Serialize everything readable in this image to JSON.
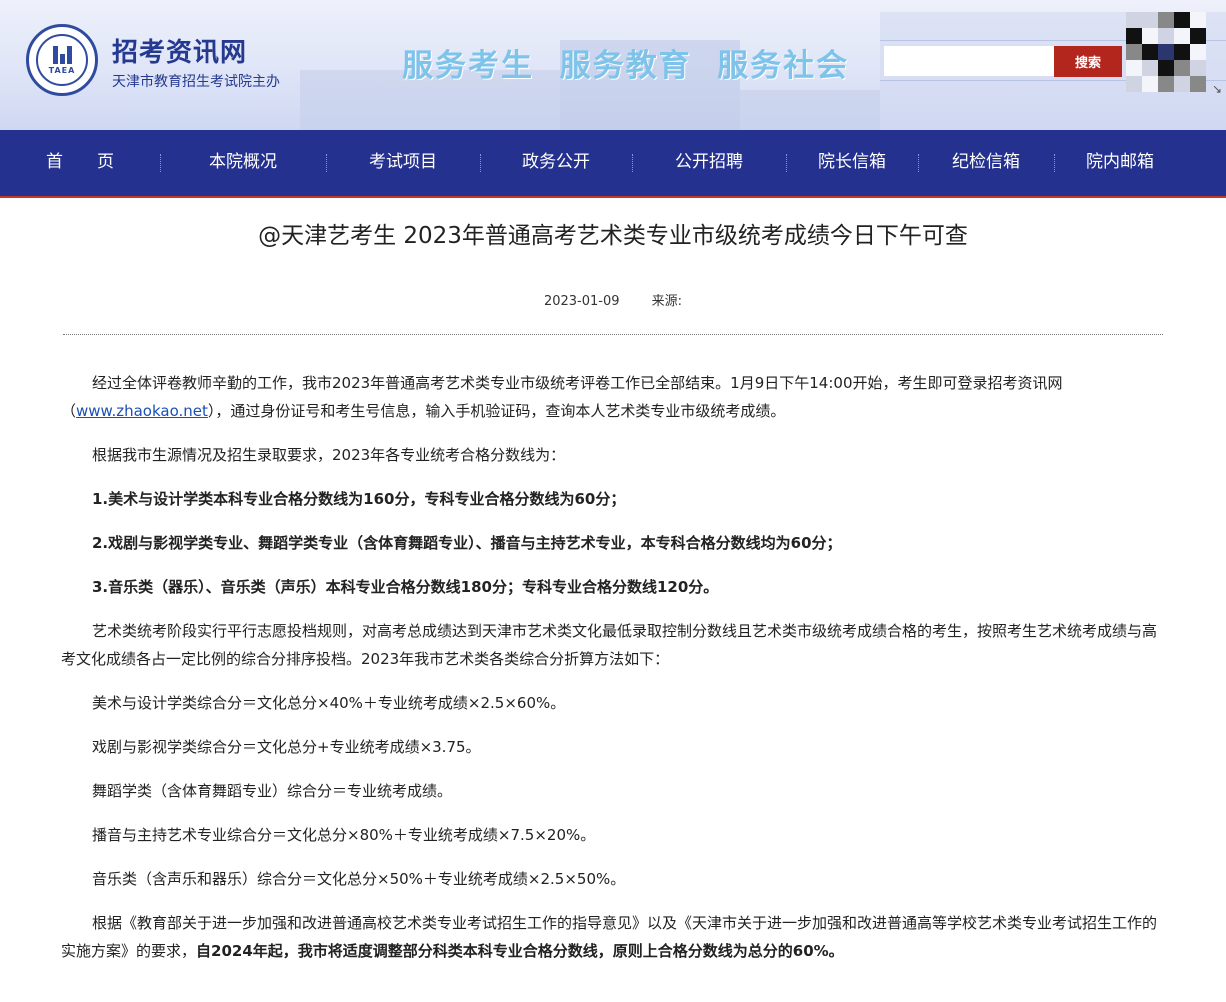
{
  "header": {
    "logo_abbr": "TAEA",
    "site_name": "招考资讯网",
    "site_sub": "天津市教育招生考试院主办",
    "slogan": "服务考生  服务教育  服务社会",
    "search_placeholder": "",
    "search_button": "搜索"
  },
  "nav": {
    "items": [
      "首　　页",
      "本院概况",
      "考试项目",
      "政务公开",
      "公开招聘",
      "院长信箱",
      "纪检信箱",
      "院内邮箱"
    ]
  },
  "article": {
    "title": "@天津艺考生 2023年普通高考艺术类专业市级统考成绩今日下午可查",
    "date": "2023-01-09",
    "source_label": "来源:",
    "p1_a": "经过全体评卷教师辛勤的工作，我市2023年普通高考艺术类专业市级统考评卷工作已全部结束。1月9日下午14:00开始，考生即可登录招考资讯网（",
    "p1_link": "www.zhaokao.net",
    "p1_b": "），通过身份证号和考生号信息，输入手机验证码，查询本人艺术类专业市级统考成绩。",
    "p2": "根据我市生源情况及招生录取要求，2023年各专业统考合格分数线为：",
    "p3": "1.美术与设计学类本科专业合格分数线为160分，专科专业合格分数线为60分；",
    "p4": "2.戏剧与影视学类专业、舞蹈学类专业（含体育舞蹈专业）、播音与主持艺术专业，本专科合格分数线均为60分；",
    "p5": "3.音乐类（器乐）、音乐类（声乐）本科专业合格分数线180分；专科专业合格分数线120分。",
    "p6": "艺术类统考阶段实行平行志愿投档规则，对高考总成绩达到天津市艺术类文化最低录取控制分数线且艺术类市级统考成绩合格的考生，按照考生艺术统考成绩与高考文化成绩各占一定比例的综合分排序投档。2023年我市艺术类各类综合分折算方法如下：",
    "p7": "美术与设计学类综合分＝文化总分×40%＋专业统考成绩×2.5×60%。",
    "p8": "戏剧与影视学类综合分＝文化总分+专业统考成绩×3.75。",
    "p9": "舞蹈学类（含体育舞蹈专业）综合分＝专业统考成绩。",
    "p10": "播音与主持艺术专业综合分＝文化总分×80%＋专业统考成绩×7.5×20%。",
    "p11": "音乐类（含声乐和器乐）综合分＝文化总分×50%＋专业统考成绩×2.5×50%。",
    "p12_a": "根据《教育部关于进一步加强和改进普通高校艺术类专业考试招生工作的指导意见》以及《天津市关于进一步加强和改进普通高等学校艺术类专业考试招生工作的实施方案》的要求，",
    "p12_b": "自2024年起，我市将适度调整部分科类本科专业合格分数线，原则上合格分数线为总分的60%。"
  },
  "colors": {
    "nav_bg": "#25318f",
    "search_button_bg": "#b3261e",
    "brand_blue": "#24398f",
    "slogan": "#7ec3ea"
  }
}
